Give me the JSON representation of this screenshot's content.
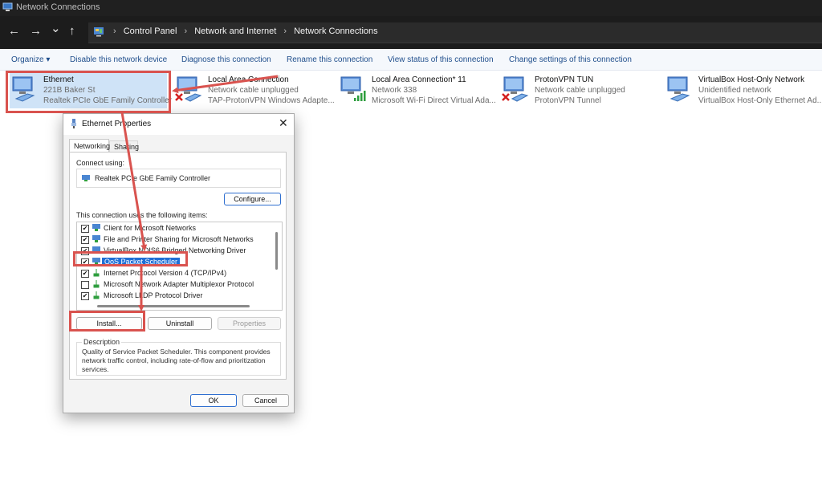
{
  "window": {
    "title": "Network Connections"
  },
  "address": {
    "nav": {
      "back": "←",
      "forward": "→",
      "recent": "⌄",
      "up": "↑"
    },
    "breadcrumbs": [
      "Control Panel",
      "Network and Internet",
      "Network Connections"
    ],
    "separator": "›"
  },
  "toolbar": {
    "organize": "Organize ▾",
    "commands": [
      "Disable this network device",
      "Diagnose this connection",
      "Rename this connection",
      "View status of this connection",
      "Change settings of this connection"
    ]
  },
  "adapters": [
    {
      "name": "Ethernet",
      "status": "221B Baker St",
      "device": "Realtek PCIe GbE Family Controller",
      "icon": "network-adapter-icon",
      "state": "connected"
    },
    {
      "name": "Local Area Connection",
      "status": "Network cable unplugged",
      "device": "TAP-ProtonVPN Windows Adapte...",
      "icon": "network-adapter-icon",
      "state": "disconnected"
    },
    {
      "name": "Local Area Connection* 11",
      "status": "Network 338",
      "device": "Microsoft Wi-Fi Direct Virtual Ada...",
      "icon": "wifi-adapter-icon",
      "state": "wifi"
    },
    {
      "name": "ProtonVPN TUN",
      "status": "Network cable unplugged",
      "device": "ProtonVPN Tunnel",
      "icon": "network-adapter-icon",
      "state": "disconnected"
    },
    {
      "name": "VirtualBox Host-Only Network",
      "status": "Unidentified network",
      "device": "VirtualBox Host-Only Ethernet Ad...",
      "icon": "network-adapter-icon",
      "state": "connected"
    }
  ],
  "dialog": {
    "title": "Ethernet Properties",
    "close": "✕",
    "tabs": [
      "Networking",
      "Sharing"
    ],
    "connect_using_label": "Connect using:",
    "adapter_name": "Realtek PCIe GbE Family Controller",
    "configure_button": "Configure...",
    "items_label": "This connection uses the following items:",
    "items": [
      {
        "label": "Client for Microsoft Networks",
        "checked": "✔",
        "icon": "network-client-icon"
      },
      {
        "label": "File and Printer Sharing for Microsoft Networks",
        "checked": "✔",
        "icon": "network-client-icon"
      },
      {
        "label": "VirtualBox NDIS6 Bridged Networking Driver",
        "checked": "✔",
        "icon": "network-client-icon"
      },
      {
        "label": "QoS Packet Scheduler",
        "checked": "✔",
        "icon": "network-client-icon"
      },
      {
        "label": "Internet Protocol Version 4 (TCP/IPv4)",
        "checked": "✔",
        "icon": "protocol-icon"
      },
      {
        "label": "Microsoft Network Adapter Multiplexor Protocol",
        "checked": "",
        "icon": "protocol-icon"
      },
      {
        "label": "Microsoft LLDP Protocol Driver",
        "checked": "✔",
        "icon": "protocol-icon"
      }
    ],
    "install_button": "Install...",
    "uninstall_button": "Uninstall",
    "properties_button": "Properties",
    "description_label": "Description",
    "description_text": "Quality of Service Packet Scheduler.  This component provides network traffic control, including rate-of-flow and prioritization services.",
    "ok_button": "OK",
    "cancel_button": "Cancel"
  },
  "colors": {
    "highlight": "#d9534f",
    "selection": "#1f6fd6",
    "link": "#1f4e8c"
  }
}
